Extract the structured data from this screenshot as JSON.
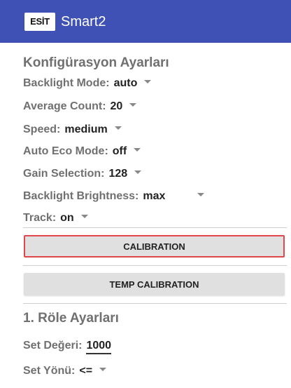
{
  "appbar": {
    "logo_text": "ESİT",
    "title": "Smart2"
  },
  "config": {
    "title": "Konfigürasyon Ayarları",
    "rows": [
      {
        "label": "Backlight Mode:",
        "value": "auto"
      },
      {
        "label": "Average Count:",
        "value": "20"
      },
      {
        "label": "Speed:",
        "value": "medium"
      },
      {
        "label": "Auto Eco Mode:",
        "value": "off"
      },
      {
        "label": "Gain Selection:",
        "value": "128"
      },
      {
        "label": "Backlight Brightness:",
        "value": "max"
      },
      {
        "label": "Track:",
        "value": "on"
      }
    ]
  },
  "buttons": {
    "calibration": "CALIBRATION",
    "temp_calibration": "TEMP CALIBRATION"
  },
  "relay": {
    "title": "1. Röle Ayarları",
    "set_value_label": "Set Değeri:",
    "set_value": "1000",
    "set_direction_label": "Set Yönü:",
    "set_direction_value": "<="
  }
}
